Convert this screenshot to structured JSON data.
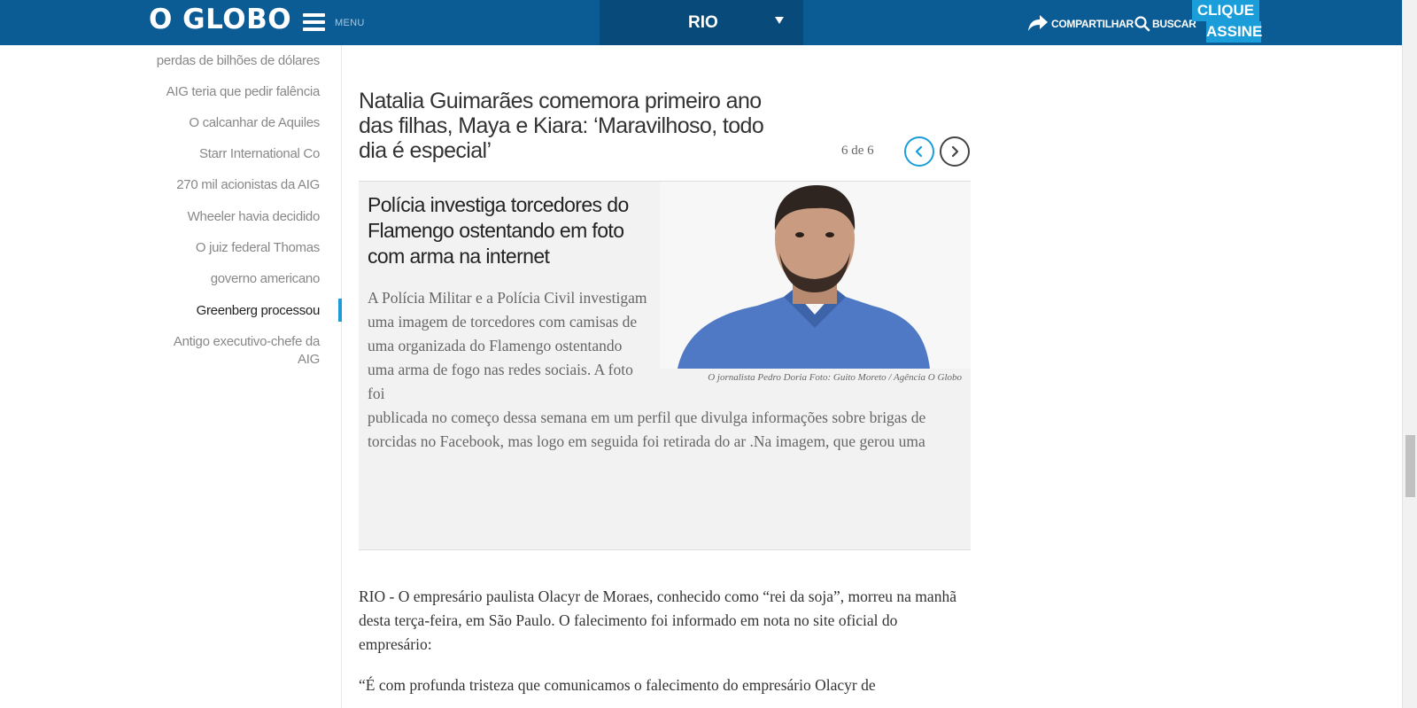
{
  "header": {
    "logo": "O GLOBO",
    "menu_label": "MENU",
    "section": "RIO",
    "share_label": "COMPARTILHAR",
    "search_label": "BUSCAR",
    "subscribe_line1": "CLIQUE E",
    "subscribe_line2": "ASSINE",
    "colors": {
      "bar": "#0b5c94",
      "section_bg": "#084a79",
      "accent": "#1a9dd9"
    }
  },
  "sidebar": {
    "items": [
      {
        "label": "perdas de bilhões de dólares"
      },
      {
        "label": "AIG teria que pedir falência"
      },
      {
        "label": "O calcanhar de Aquiles"
      },
      {
        "label": "Starr International Co"
      },
      {
        "label": "270 mil acionistas da AIG"
      },
      {
        "label": "Wheeler havia decidido"
      },
      {
        "label": "O juiz federal Thomas"
      },
      {
        "label": "governo americano"
      },
      {
        "label": "Greenberg processou"
      },
      {
        "label": "Antigo executivo-chefe da AIG"
      }
    ],
    "active_index": 8
  },
  "related": {
    "title": "Natalia Guimarães comemora primeiro ano das filhas, Maya e Kiara: ‘Maravilhoso, todo dia é especial’",
    "counter": "6 de 6",
    "card": {
      "title": "Polícia investiga torcedores do Flamengo ostentando em foto com arma na internet",
      "text_part1": "A Polícia Militar e a Polícia Civil investigam uma imagem de torcedores com camisas de uma organizada do Flamengo ostentando uma arma de fogo nas redes sociais. A foto foi",
      "text_part2": "publicada no começo dessa semana em um perfil que divulga informações sobre brigas de torcidas no Facebook, mas logo em seguida foi retirada do ar .Na imagem, que gerou uma",
      "caption": "O jornalista Pedro Doria Foto: Guito Moreto / Agência O Globo"
    }
  },
  "article": {
    "paragraphs": [
      "RIO - O empresário paulista Olacyr de Moraes, conhecido como “rei da soja”, morreu na manhã desta terça-feira, em São Paulo. O falecimento foi informado em nota no site oficial do empresário:",
      "“É com profunda tristeza que comunicamos o falecimento do empresário Olacyr de"
    ]
  }
}
